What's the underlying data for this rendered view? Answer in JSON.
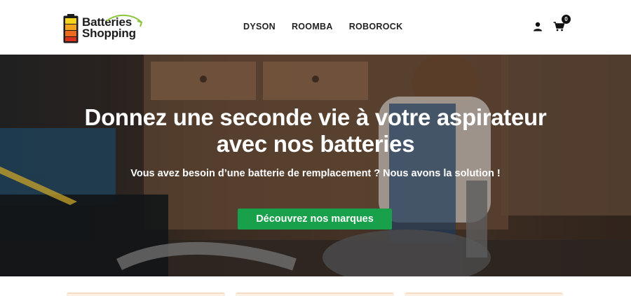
{
  "brand": {
    "name_line1": "Batteries",
    "name_line2": "Shopping",
    "battery_colors": [
      "#f7d31c",
      "#f4a21b",
      "#ee6a1f",
      "#d9321f"
    ],
    "swoosh_color": "#8bc53f"
  },
  "nav": {
    "items": [
      {
        "label": "DYSON"
      },
      {
        "label": "ROOMBA"
      },
      {
        "label": "ROBOROCK"
      }
    ]
  },
  "header_actions": {
    "user_icon": "user-icon",
    "cart_icon": "cart-icon",
    "cart_count": "0"
  },
  "hero": {
    "title_line1": "Donnez une seconde vie à votre aspirateur",
    "title_line2": "avec nos batteries",
    "subtitle": "Vous avez besoin d’une batterie de remplacement ? Nous avons la solution !",
    "cta_label": "Découvrez nos marques",
    "cta_color": "#18a04a"
  }
}
